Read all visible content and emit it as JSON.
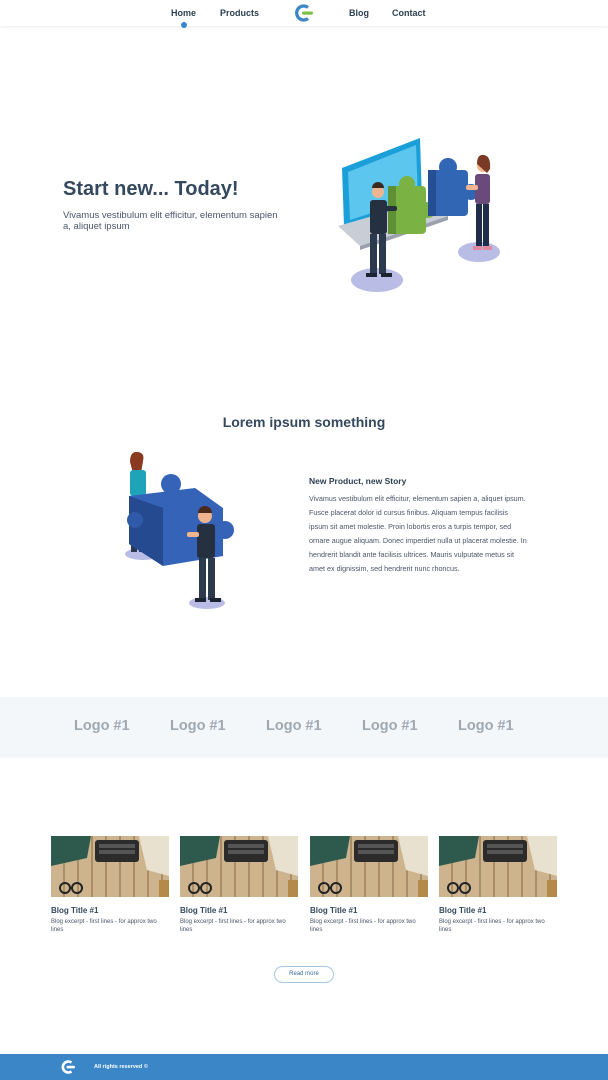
{
  "nav": {
    "items": [
      {
        "label": "Home",
        "active": true
      },
      {
        "label": "Products"
      },
      {
        "label": "Blog"
      },
      {
        "label": "Contact"
      }
    ],
    "logo_icon": "c-logo-icon"
  },
  "hero": {
    "title": "Start new... Today!",
    "subtitle": "Vivamus vestibulum elit efficitur, elementum sapien a, aliquet ipsum"
  },
  "section2": {
    "title": "Lorem ipsum something",
    "story_title": "New Product, new Story",
    "story_body": "Vivamus vestibulum elit efficitur, elementum sapien a, aliquet ipsum. Fusce placerat dolor id cursus finibus. Aliquam tempus facilisis ipsum sit amet molestie. Proin lobortis eros a turpis tempor, sed ornare augue aliquam. Donec imperdiet nulla ut placerat molestie. In hendrerit blandit ante facilisis ultrices. Mauris vulputate metus sit amet ex dignissim, sed hendrerit nunc rhoncus."
  },
  "logos": [
    "Logo #1",
    "Logo #1",
    "Logo #1",
    "Logo #1",
    "Logo #1"
  ],
  "blog": {
    "cards": [
      {
        "title": "Blog Title #1",
        "excerpt": "Blog excerpt - first lines - for approx two lines"
      },
      {
        "title": "Blog Title #1",
        "excerpt": "Blog excerpt - first lines - for approx two lines"
      },
      {
        "title": "Blog Title #1",
        "excerpt": "Blog excerpt - first lines - for approx two lines"
      },
      {
        "title": "Blog Title #1",
        "excerpt": "Blog excerpt - first lines - for approx two lines"
      }
    ],
    "read_more": "Read more"
  },
  "footer": {
    "text": "All rights reserved ©"
  },
  "colors": {
    "accent": "#3b86c7",
    "heading": "#34495e",
    "logo_gray": "#a0a8b0",
    "band": "#f3f7fa"
  }
}
